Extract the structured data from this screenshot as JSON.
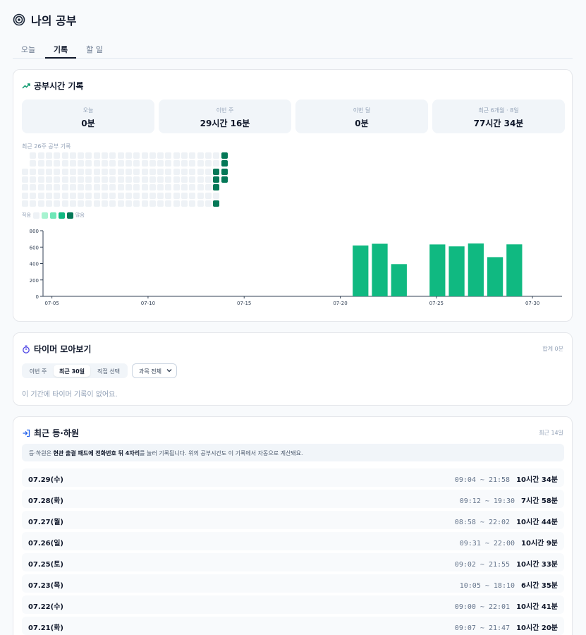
{
  "page": {
    "title": "나의 공부"
  },
  "tabs": [
    {
      "label": "오늘",
      "active": false
    },
    {
      "label": "기록",
      "active": true
    },
    {
      "label": "할 일",
      "active": false
    }
  ],
  "study_log": {
    "title": "공부시간 기록",
    "stats": [
      {
        "label": "오늘",
        "value": "0분"
      },
      {
        "label": "이번 주",
        "value": "29시간 16분"
      },
      {
        "label": "이번 달",
        "value": "0분"
      },
      {
        "label": "최근 6개월 · 8일",
        "value": "77시간 34분"
      }
    ],
    "heatmap": {
      "caption": "최근 26주 공부 기록",
      "legend_less": "적음",
      "legend_more": "많음",
      "legend_colors": [
        "#eef2f6",
        "#a7f3d0",
        "#6ee7b7",
        "#10b981",
        "#047857"
      ],
      "weeks": 26,
      "active_cells": [
        {
          "week": 24,
          "day": 2,
          "level": 4
        },
        {
          "week": 24,
          "day": 3,
          "level": 4
        },
        {
          "week": 24,
          "day": 4,
          "level": 4
        },
        {
          "week": 24,
          "day": 6,
          "level": 4
        },
        {
          "week": 25,
          "day": 0,
          "level": 4
        },
        {
          "week": 25,
          "day": 1,
          "level": 4
        },
        {
          "week": 25,
          "day": 2,
          "level": 4
        },
        {
          "week": 25,
          "day": 3,
          "level": 4
        }
      ]
    }
  },
  "chart_data": {
    "type": "bar",
    "x": [
      "07-05",
      "07-06",
      "07-07",
      "07-08",
      "07-09",
      "07-10",
      "07-11",
      "07-12",
      "07-13",
      "07-14",
      "07-15",
      "07-16",
      "07-17",
      "07-18",
      "07-19",
      "07-20",
      "07-21",
      "07-22",
      "07-23",
      "07-24",
      "07-25",
      "07-26",
      "07-27",
      "07-28",
      "07-29",
      "07-30",
      "07-31"
    ],
    "values": [
      0,
      0,
      0,
      0,
      0,
      0,
      0,
      0,
      0,
      0,
      0,
      0,
      0,
      0,
      0,
      0,
      620,
      641,
      393,
      0,
      633,
      609,
      644,
      478,
      634,
      0,
      0
    ],
    "x_tick_labels": [
      "07-05",
      "07-10",
      "07-15",
      "07-20",
      "07-25",
      "07-30"
    ],
    "y_ticks": [
      0,
      200,
      400,
      600,
      800
    ],
    "ylim": [
      0,
      800
    ],
    "bar_color": "#10b981"
  },
  "timers": {
    "title": "타이머 모아보기",
    "total": "합계 0분",
    "segments": [
      {
        "label": "이번 주",
        "active": false
      },
      {
        "label": "최근 30일",
        "active": true
      },
      {
        "label": "직접 선택",
        "active": false
      }
    ],
    "subject_filter": "과목 전체",
    "empty_message": "이 기간에 타이머 기록이 없어요."
  },
  "attendance": {
    "title": "최근 등·하원",
    "meta": "최근 14일",
    "notice_prefix": "등·하원은 ",
    "notice_bold": "현관 출결 패드에 전화번호 뒤 4자리",
    "notice_suffix": "를 눌러 기록됩니다. 위의 공부시간도 이 기록에서 자동으로 계산돼요.",
    "rows": [
      {
        "date": "07.29(수)",
        "range": "09:04 ~ 21:58",
        "duration": "10시간 34분"
      },
      {
        "date": "07.28(화)",
        "range": "09:12 ~ 19:30",
        "duration": "7시간 58분"
      },
      {
        "date": "07.27(월)",
        "range": "08:58 ~ 22:02",
        "duration": "10시간 44분"
      },
      {
        "date": "07.26(일)",
        "range": "09:31 ~ 22:00",
        "duration": "10시간 9분"
      },
      {
        "date": "07.25(토)",
        "range": "09:02 ~ 21:55",
        "duration": "10시간 33분"
      },
      {
        "date": "07.23(목)",
        "range": "10:05 ~ 18:10",
        "duration": "6시간 35분"
      },
      {
        "date": "07.22(수)",
        "range": "09:00 ~ 22:01",
        "duration": "10시간 41분"
      },
      {
        "date": "07.21(화)",
        "range": "09:07 ~ 21:47",
        "duration": "10시간 20분"
      }
    ]
  }
}
